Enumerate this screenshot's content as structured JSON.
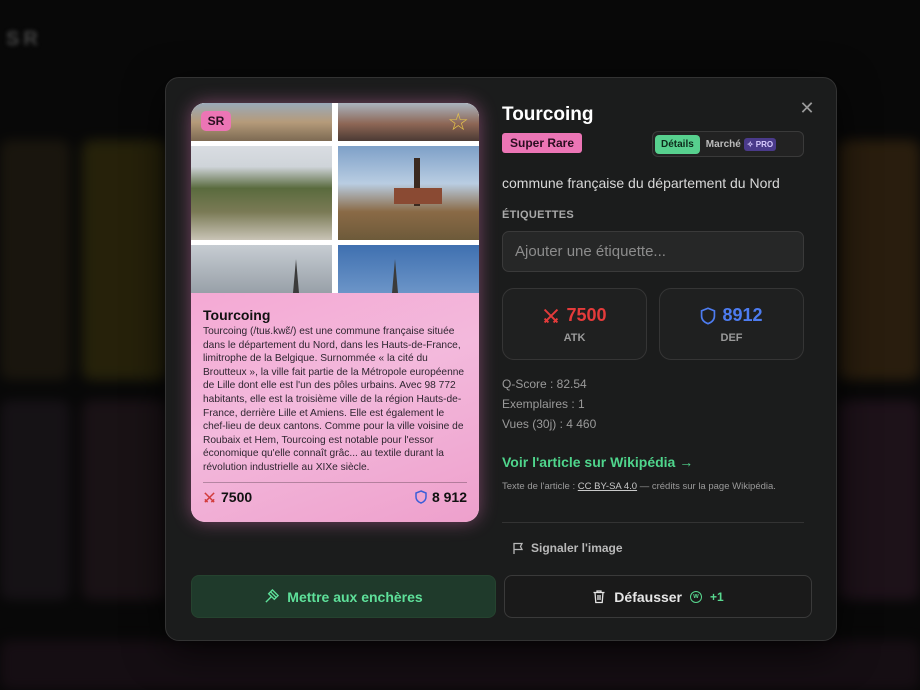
{
  "background": {
    "app_title": "SR"
  },
  "modal": {
    "close_icon": "close-icon"
  },
  "card": {
    "rarity_badge": "SR",
    "title": "Tourcoing",
    "description": "Tourcoing (/tuʁ.kwɛ̃/) est une commune française située dans le département du Nord, dans les Hauts-de-France, limitrophe de la Belgique. Surnommée « la cité du Broutteux », la ville fait partie de la Métropole européenne de Lille dont elle est l'un des pôles urbains. Avec 98 772 habitants, elle est la troisième ville de la région Hauts-de-France, derrière Lille et Amiens. Elle est également le chef-lieu de deux cantons. Comme pour la ville voisine de Roubaix et Hem, Tourcoing est notable pour l'essor économique qu'elle connaît grâc... au textile durant la révolution industrielle au XIXe siècle.",
    "atk": "7500",
    "def": "8 912"
  },
  "details": {
    "name": "Tourcoing",
    "rarity_label": "Super Rare",
    "tabs": {
      "details": "Détails",
      "market": "Marché",
      "pro_badge": "PRO"
    },
    "subtitle": "commune française du département du Nord",
    "tags_label": "ÉTIQUETTES",
    "tag_placeholder": "Ajouter une étiquette...",
    "atk_value": "7500",
    "atk_label": "ATK",
    "def_value": "8912",
    "def_label": "DEF",
    "qscore": "Q-Score : 82.54",
    "copies": "Exemplaires : 1",
    "views": "Vues (30j) : 4 460",
    "wiki_link": "Voir l'article sur Wikipédia →",
    "license_prefix": "Texte de l'article :",
    "license_name": "CC BY-SA 4.0",
    "license_suffix": "— crédits sur la page Wikipédia.",
    "report_label": "Signaler l'image"
  },
  "actions": {
    "auction_label": "Mettre aux enchères",
    "dust_label": "Défausser",
    "dust_reward": "+1"
  },
  "colors": {
    "accent": "#4fd58c",
    "rarity": "#ec75b5",
    "atk": "#e43b3b",
    "def": "#4d7cf0"
  }
}
